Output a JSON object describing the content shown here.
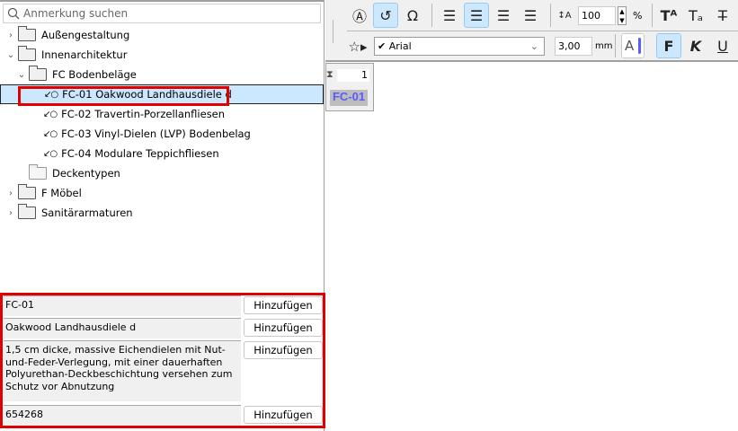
{
  "search": {
    "placeholder": "Anmerkung suchen"
  },
  "tree": [
    {
      "label": "Außengestaltung",
      "level": 0,
      "chev": "›",
      "kind": "folder"
    },
    {
      "label": "Innenarchitektur",
      "level": 0,
      "chev": "⌄",
      "kind": "folder"
    },
    {
      "label": "FC Bodenbeläge",
      "level": 1,
      "chev": "⌄",
      "kind": "folder"
    },
    {
      "label": "FC-01 Oakwood Landhausdiele d",
      "level": 2,
      "kind": "leaf",
      "selected": true
    },
    {
      "label": "FC-02 Travertin-Porzellanfliesen",
      "level": 2,
      "kind": "leaf"
    },
    {
      "label": "FC-03 Vinyl-Dielen (LVP) Bodenbelag",
      "level": 2,
      "kind": "leaf"
    },
    {
      "label": "FC-04 Modulare Teppichfliesen",
      "level": 2,
      "kind": "leaf"
    },
    {
      "label": "Deckentypen",
      "level": 1,
      "kind": "folder-empty"
    },
    {
      "label": "F Möbel",
      "level": 0,
      "chev": "›",
      "kind": "folder"
    },
    {
      "label": "Sanitärarmaturen",
      "level": 0,
      "chev": "›",
      "kind": "folder"
    }
  ],
  "fields": [
    {
      "value": "FC-01",
      "button": "Hinzufügen"
    },
    {
      "value": "Oakwood Landhausdiele d",
      "button": "Hinzufügen"
    },
    {
      "value": "1,5 cm dicke, massive Eichendielen mit Nut-und-Feder-Verlegung, mit einer dauerhaften Polyurethan-Deckbeschichtung versehen zum Schutz vor Abnutzung",
      "button": "Hinzufügen"
    },
    {
      "value": "654268",
      "button": "Hinzufügen"
    }
  ],
  "toolbar": {
    "line_spacing": "100",
    "percent": "%",
    "font": "Arial",
    "font_check": "✔",
    "size": "3,00",
    "unit": "mm",
    "bold": "F",
    "italic": "K",
    "underline": "U",
    "color_sample": "A"
  },
  "label_widget": {
    "count": "1",
    "tag": "FC-01"
  },
  "colors": {
    "accent": "#cce8ff",
    "highlight": "#e00000",
    "tag_text": "#5a5aff"
  }
}
